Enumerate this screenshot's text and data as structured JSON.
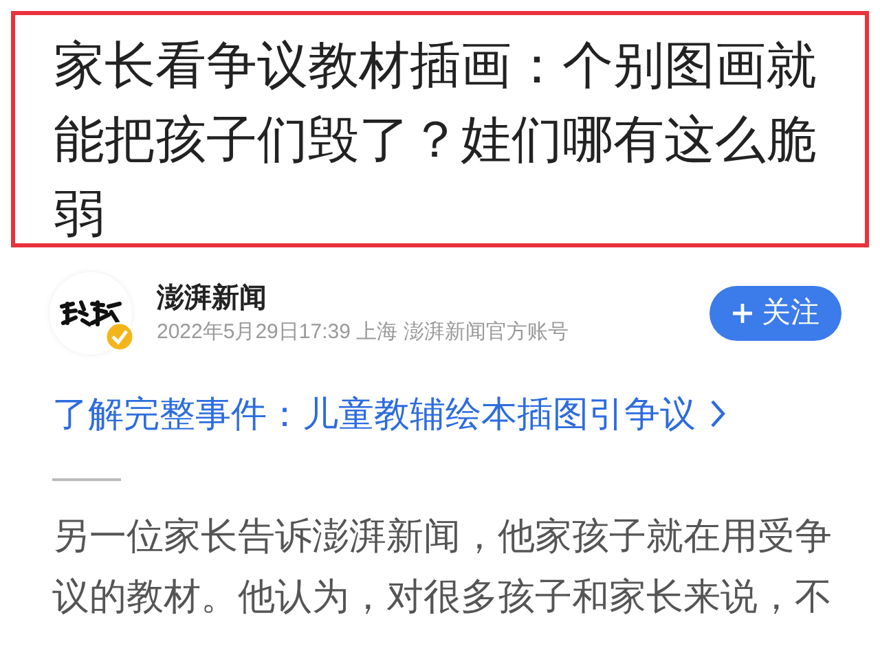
{
  "headline": "家长看争议教材插画：个别图画就能把孩子们毁了？娃们哪有这么脆弱",
  "author": {
    "name": "澎湃新闻",
    "verified": true,
    "meta": "2022年5月29日17:39 上海 澎湃新闻官方账号",
    "follow_button": "关注"
  },
  "event_link": "了解完整事件：儿童教辅绘本插图引争议",
  "paragraph": "另一位家长告诉澎湃新闻，他家孩子就在用受争议的教材。他认为，对很多孩子和家长来说，不"
}
